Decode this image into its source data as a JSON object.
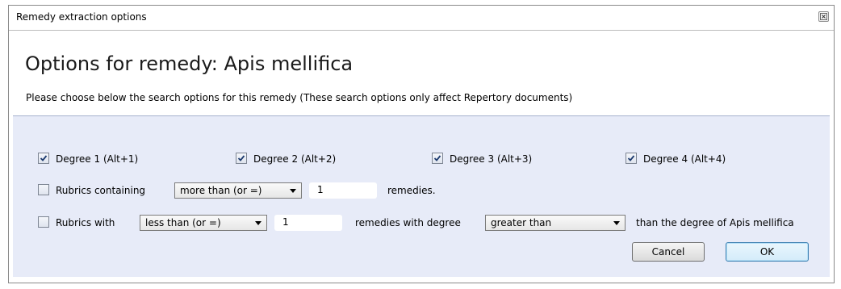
{
  "window": {
    "title": "Remedy extraction options",
    "close_icon": "close-icon"
  },
  "header": {
    "heading": "Options for remedy: Apis mellifica",
    "description": "Please choose below the search options for this remedy (These search options only affect Repertory documents)"
  },
  "degrees": [
    {
      "label": "Degree 1 (Alt+1)",
      "checked": true
    },
    {
      "label": "Degree 2 (Alt+2)",
      "checked": true
    },
    {
      "label": "Degree 3 (Alt+3)",
      "checked": true
    },
    {
      "label": "Degree 4 (Alt+4)",
      "checked": true
    }
  ],
  "rubrics_containing": {
    "checked": false,
    "label": "Rubrics containing",
    "comparator": "more than (or =)",
    "count": "1",
    "suffix": "remedies."
  },
  "rubrics_with": {
    "checked": false,
    "label": "Rubrics with",
    "comparator": "less than (or =)",
    "count": "1",
    "middle_text": "remedies with degree",
    "degree_comparator": "greater than",
    "suffix": "than the degree of Apis mellifica"
  },
  "buttons": {
    "cancel": "Cancel",
    "ok": "OK"
  },
  "colors": {
    "panel_bg": "#e7ebf8",
    "accent": "#3c7fb1"
  }
}
